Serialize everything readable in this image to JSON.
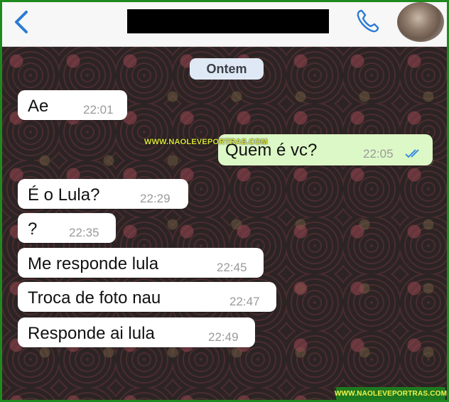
{
  "header": {
    "back_icon": "chevron-left-icon",
    "call_icon": "phone-icon",
    "contact_name": ""
  },
  "chat": {
    "date_label": "Ontem",
    "messages": [
      {
        "text": "Ae",
        "time": "22:01",
        "direction": "in"
      },
      {
        "text": "Quem é vc?",
        "time": "22:05",
        "direction": "out",
        "status": "read"
      },
      {
        "text": "É o Lula?",
        "time": "22:29",
        "direction": "in"
      },
      {
        "text": "?",
        "time": "22:35",
        "direction": "in"
      },
      {
        "text": "Me responde lula",
        "time": "22:45",
        "direction": "in"
      },
      {
        "text": "Troca de foto nau",
        "time": "22:47",
        "direction": "in"
      },
      {
        "text": "Responde ai lula",
        "time": "22:49",
        "direction": "in"
      }
    ]
  },
  "watermarks": {
    "middle": "WWW.NAOLEVEPORTRAS.COM",
    "bottom": "WWW.NAOLEVEPORTRAS.COM"
  },
  "colors": {
    "incoming_bubble": "#ffffff",
    "outgoing_bubble": "#dcf8c6",
    "accent": "#2b7bd4",
    "frame": "#1e8a1e"
  }
}
